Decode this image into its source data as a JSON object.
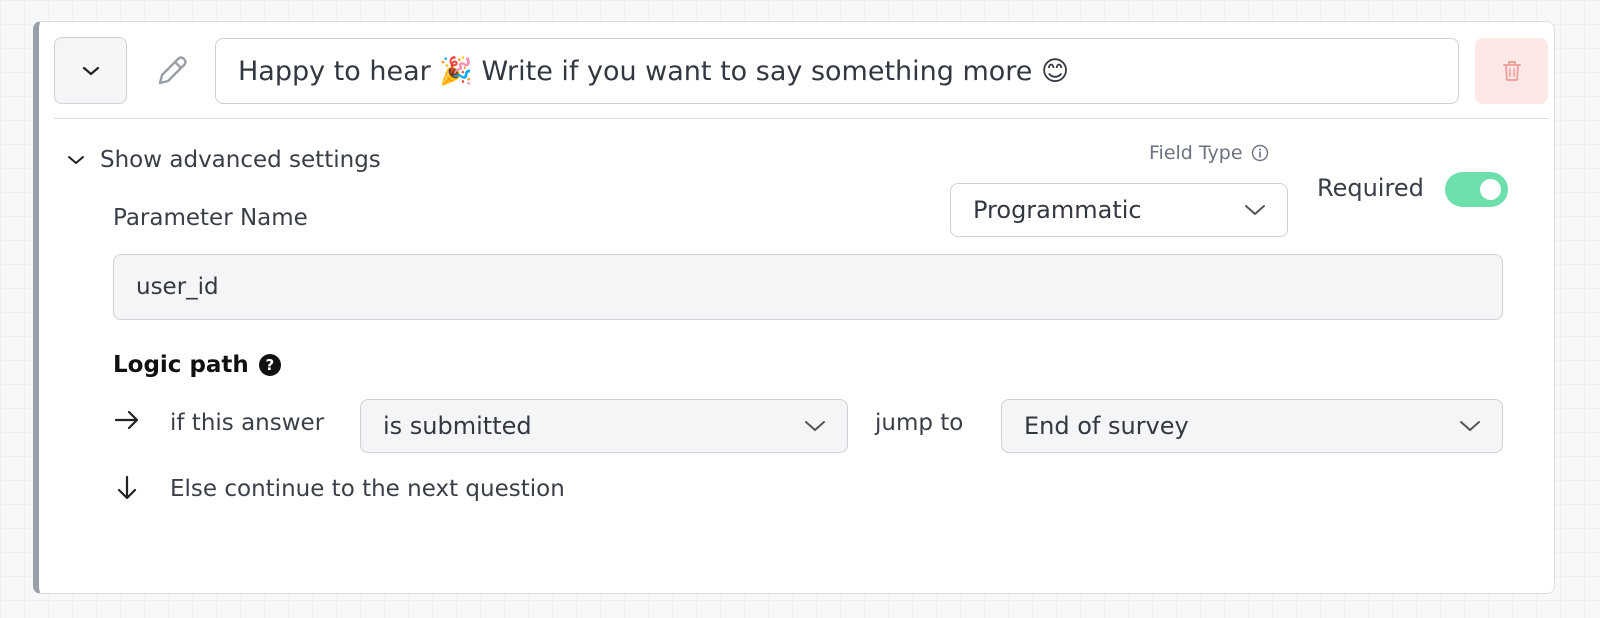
{
  "question": {
    "headline": "Happy to hear 🎉 Write if you want to say something more 😊"
  },
  "advanced": {
    "toggle_label": "Show advanced settings",
    "field_type_label": "Field Type",
    "field_type_value": "Programmatic",
    "required_label": "Required",
    "required_on": true,
    "parameter_name_label": "Parameter Name",
    "parameter_name_value": "user_id"
  },
  "logic": {
    "title": "Logic path",
    "if_text": "if this answer",
    "condition_value": "is submitted",
    "jump_text": "jump to",
    "target_value": "End of survey",
    "else_text": "Else continue to the next question"
  },
  "colors": {
    "toggle_on": "#6ddfab",
    "delete_bg": "#fde8e8",
    "delete_icon": "#f0a3a3"
  },
  "icons": [
    "chevron-down-icon",
    "pencil-icon",
    "trash-icon",
    "info-icon",
    "help-icon",
    "arrow-right-icon",
    "arrow-down-icon"
  ]
}
